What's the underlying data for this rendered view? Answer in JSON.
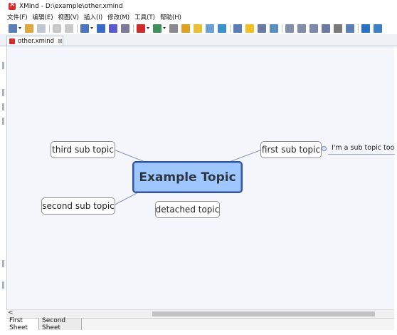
{
  "window": {
    "title": "XMind - D:\\example\\other.xmind"
  },
  "menu": [
    "文件(F)",
    "编辑(E)",
    "视图(V)",
    "插入(I)",
    "修改(M)",
    "工具(T)",
    "帮助(H)"
  ],
  "toolbar": {
    "icons": [
      {
        "name": "new-file-icon",
        "color": "#5a7fb8"
      },
      {
        "name": "open-folder-icon",
        "color": "#e0a83a"
      },
      {
        "name": "save-icon",
        "color": "#bfc6d0"
      },
      {
        "name": "undo-icon",
        "color": "#c8c8c8"
      },
      {
        "name": "redo-icon",
        "color": "#c8c8c8"
      },
      {
        "name": "insert-topic-icon",
        "color": "#4a74c0"
      },
      {
        "name": "topic-structure-icon",
        "color": "#3c6ac8"
      },
      {
        "name": "boundary-icon",
        "color": "#5b5bd0"
      },
      {
        "name": "relationship-icon",
        "color": "#7a7a9a"
      },
      {
        "name": "marker-flag-icon",
        "color": "#d02a2a"
      },
      {
        "name": "image-icon",
        "color": "#3e8f5a"
      },
      {
        "name": "hyperlink-icon",
        "color": "#8a8a8a"
      },
      {
        "name": "attachment-icon",
        "color": "#e0a020"
      },
      {
        "name": "note-icon",
        "color": "#e8c030"
      },
      {
        "name": "label-icon",
        "color": "#6aa0d8"
      },
      {
        "name": "globe-icon",
        "color": "#3a90c8"
      },
      {
        "name": "style-icon",
        "color": "#5a7fb8"
      },
      {
        "name": "idea-bulb-icon",
        "color": "#f0c020"
      },
      {
        "name": "outline-icon",
        "color": "#6a7aa0"
      },
      {
        "name": "export-icon",
        "color": "#5a90c0"
      },
      {
        "name": "zoom-in-icon",
        "color": "#8090a8"
      },
      {
        "name": "zoom-out-icon",
        "color": "#8090a8"
      },
      {
        "name": "gantt-icon",
        "color": "#7a8aa8"
      },
      {
        "name": "presentation-icon",
        "color": "#6a7aa0"
      },
      {
        "name": "clock-icon",
        "color": "#7a7a7a"
      },
      {
        "name": "search-icon",
        "color": "#5a7fb8"
      },
      {
        "name": "upload-cloud-icon",
        "color": "#2a70c8"
      },
      {
        "name": "share-icon",
        "color": "#3a80c8"
      }
    ]
  },
  "editor_tab": {
    "label": "other.xmind",
    "close_symbol": "⊠"
  },
  "mindmap": {
    "central_topic": "Example Topic",
    "topics": {
      "first": "first sub topic",
      "second": "second sub topic",
      "third": "third sub topic",
      "detached": "detached topic",
      "sub_of_first": "I'm a sub topic too"
    },
    "connector_color": "#8a97b0"
  },
  "scrollbar": {
    "left_arrow": "<"
  },
  "sheets": [
    "First Sheet",
    "Second Sheet"
  ]
}
